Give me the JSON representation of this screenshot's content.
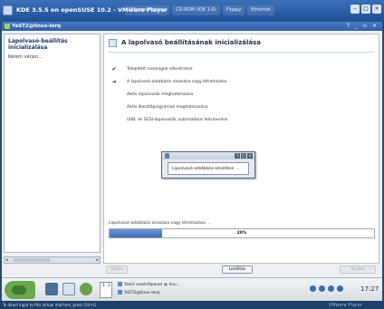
{
  "host": {
    "title": "KDE 3.5.5 on openSUSE 10.2 - VMware Player",
    "tabs": [
      {
        "label": "VMware Player ▾"
      },
      {
        "label": "CD-ROM (IDE 1:0)"
      },
      {
        "label": "Floppy"
      },
      {
        "label": "Ethernet"
      }
    ],
    "status_text": "To direct input to this virtual machine, press Ctrl+G",
    "brand": "VMware Player"
  },
  "guest_window": {
    "title": "YaST2@linux-lorq",
    "controls": "? _ ▫ ×"
  },
  "help": {
    "title": "Lapolvasó-beállítás inicializálása",
    "text": "Kérem várjon..."
  },
  "main": {
    "title": "A lapolvasó beállításának inicializálása",
    "steps": [
      {
        "mark": "✔",
        "text": "Telepített csomagok ellenőrzése"
      },
      {
        "mark": "➜",
        "text": "A lapolvasó-adatbázis olvasása vagy létrehozása"
      },
      {
        "mark": "",
        "text": "Aktív lapolvasók meghatározása"
      },
      {
        "mark": "",
        "text": "Aktív illesztőprogramok meghatározása"
      },
      {
        "mark": "",
        "text": "USB- és SCSI-lapolvasók automatikus felismerése"
      }
    ],
    "progress_label": "Lapolvasó-adatbázis olvasása vagy létrehozása ...",
    "progress_value": 20,
    "progress_text": "20%"
  },
  "dialog": {
    "text": "Lapolvasó-adatbázis készítése ..."
  },
  "buttons": {
    "back": "Vissza",
    "abort": "Leállítás",
    "next": "Tovább"
  },
  "taskbar": {
    "pager": [
      "1",
      "2"
    ],
    "tasks": [
      "Yast2 vezérlőpanel @ linu...",
      "YaST2@linux-lorq"
    ],
    "clock": "17:27"
  }
}
